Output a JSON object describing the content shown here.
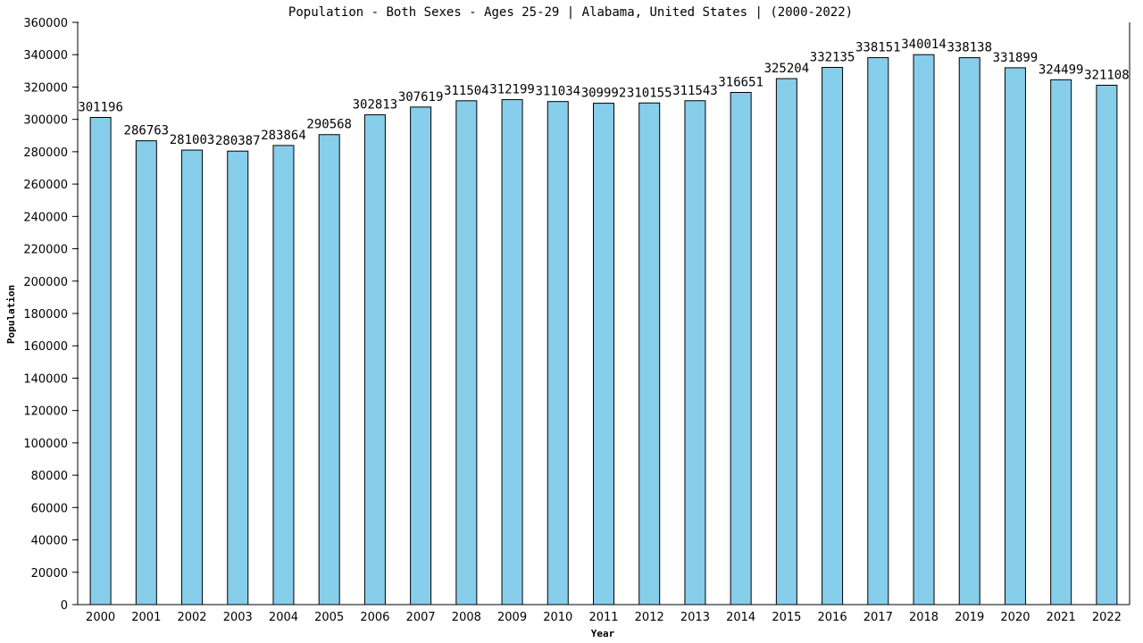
{
  "chart_data": {
    "type": "bar",
    "title": "Population - Both Sexes - Ages 25-29 | Alabama, United States |  (2000-2022)",
    "xlabel": "Year",
    "ylabel": "Population",
    "ylim": [
      0,
      360000
    ],
    "yticks": [
      0,
      20000,
      40000,
      60000,
      80000,
      100000,
      120000,
      140000,
      160000,
      180000,
      200000,
      220000,
      240000,
      260000,
      280000,
      300000,
      320000,
      340000,
      360000
    ],
    "grid": false,
    "legend": "none",
    "bar_color": "#87ceeb",
    "bar_edge_color": "#000000",
    "categories": [
      "2000",
      "2001",
      "2002",
      "2003",
      "2004",
      "2005",
      "2006",
      "2007",
      "2008",
      "2009",
      "2010",
      "2011",
      "2012",
      "2013",
      "2014",
      "2015",
      "2016",
      "2017",
      "2018",
      "2019",
      "2020",
      "2021",
      "2022"
    ],
    "values": [
      301196,
      286763,
      281003,
      280387,
      283864,
      290568,
      302813,
      307619,
      311504,
      312199,
      311034,
      309992,
      310155,
      311543,
      316651,
      325204,
      332135,
      338151,
      340014,
      338138,
      331899,
      324499,
      321108
    ]
  }
}
